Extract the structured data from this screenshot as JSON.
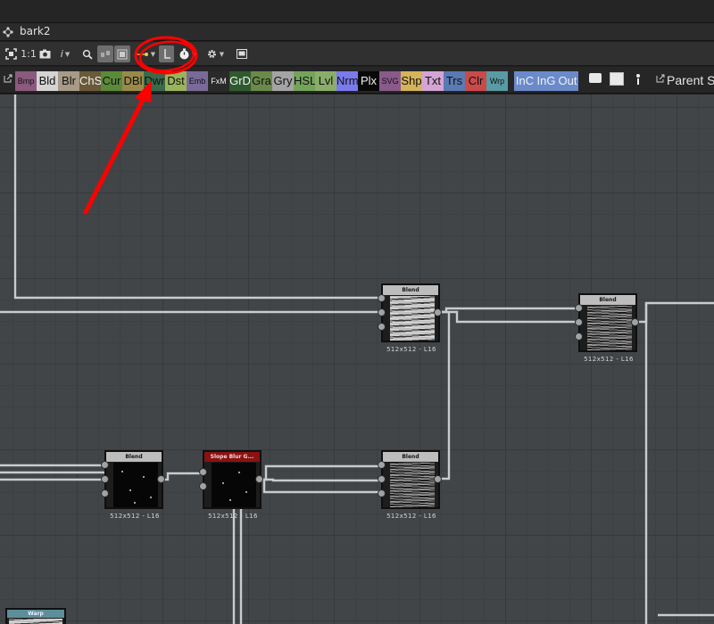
{
  "window": {
    "tab_title": "bark2"
  },
  "toolbar": {
    "zoom_1to1": "1:1",
    "info": "i",
    "highlighted_tool": "layout-snap"
  },
  "atom_bar": {
    "atoms": [
      {
        "label": "Bmp",
        "color": "#8b5a7e",
        "small": true
      },
      {
        "label": "Bld",
        "color": "#d4d4d4"
      },
      {
        "label": "Blr",
        "color": "#a79b87"
      },
      {
        "label": "ChS",
        "color": "#6a5a3a",
        "light": true
      },
      {
        "label": "Cur",
        "color": "#5a8a3a"
      },
      {
        "label": "DBl",
        "color": "#9a8a4a"
      },
      {
        "label": "Dwr",
        "color": "#3a6a4a"
      },
      {
        "label": "Dst",
        "color": "#9ab45a"
      },
      {
        "label": "Emb",
        "color": "#7a6a9a",
        "small": true
      },
      {
        "label": "FxM",
        "color": "#2a2a2a",
        "small": true,
        "light": true
      },
      {
        "label": "GrD",
        "color": "#2e5a2e",
        "light": true
      },
      {
        "label": "Gra",
        "color": "#6a8a4a"
      },
      {
        "label": "Gry",
        "color": "#a4a4a4"
      },
      {
        "label": "HSL",
        "color": "#74a45a"
      },
      {
        "label": "Lvl",
        "color": "#8aae6a"
      },
      {
        "label": "Nrm",
        "color": "#7a7aee"
      },
      {
        "label": "Plx",
        "color": "#080808",
        "light": true
      },
      {
        "label": "SVG",
        "color": "#8a5a8a",
        "small": true
      },
      {
        "label": "Shp",
        "color": "#d4b45a"
      },
      {
        "label": "Txt",
        "color": "#d4a4d4"
      },
      {
        "label": "Trs",
        "color": "#5a7ab4"
      },
      {
        "label": "Clr",
        "color": "#ca4a4a"
      },
      {
        "label": "Wrp",
        "color": "#5a9aa4",
        "small": true
      },
      {
        "label": "InC",
        "color": "#6a8aca",
        "light": true
      },
      {
        "label": "InG",
        "color": "#6a8aca",
        "light": true
      },
      {
        "label": "Out",
        "color": "#6a8aca",
        "light": true
      }
    ],
    "parent_size_label": "Parent S"
  },
  "graph": {
    "nodes": [
      {
        "id": "blend-top",
        "title": "Blend",
        "label": "512x512 - L16"
      },
      {
        "id": "blend-right",
        "title": "Blend",
        "label": "512x512 - L16"
      },
      {
        "id": "blend-left",
        "title": "Blend",
        "label": "512x512 - L16"
      },
      {
        "id": "slope-blur",
        "title": "Slope Blur G...",
        "label": "512x512 - L16"
      },
      {
        "id": "blend-bottom",
        "title": "Blend",
        "label": "512x512 - L16"
      }
    ],
    "warp_node_title": "Warp"
  },
  "annotation": {
    "color": "#ff0000"
  }
}
